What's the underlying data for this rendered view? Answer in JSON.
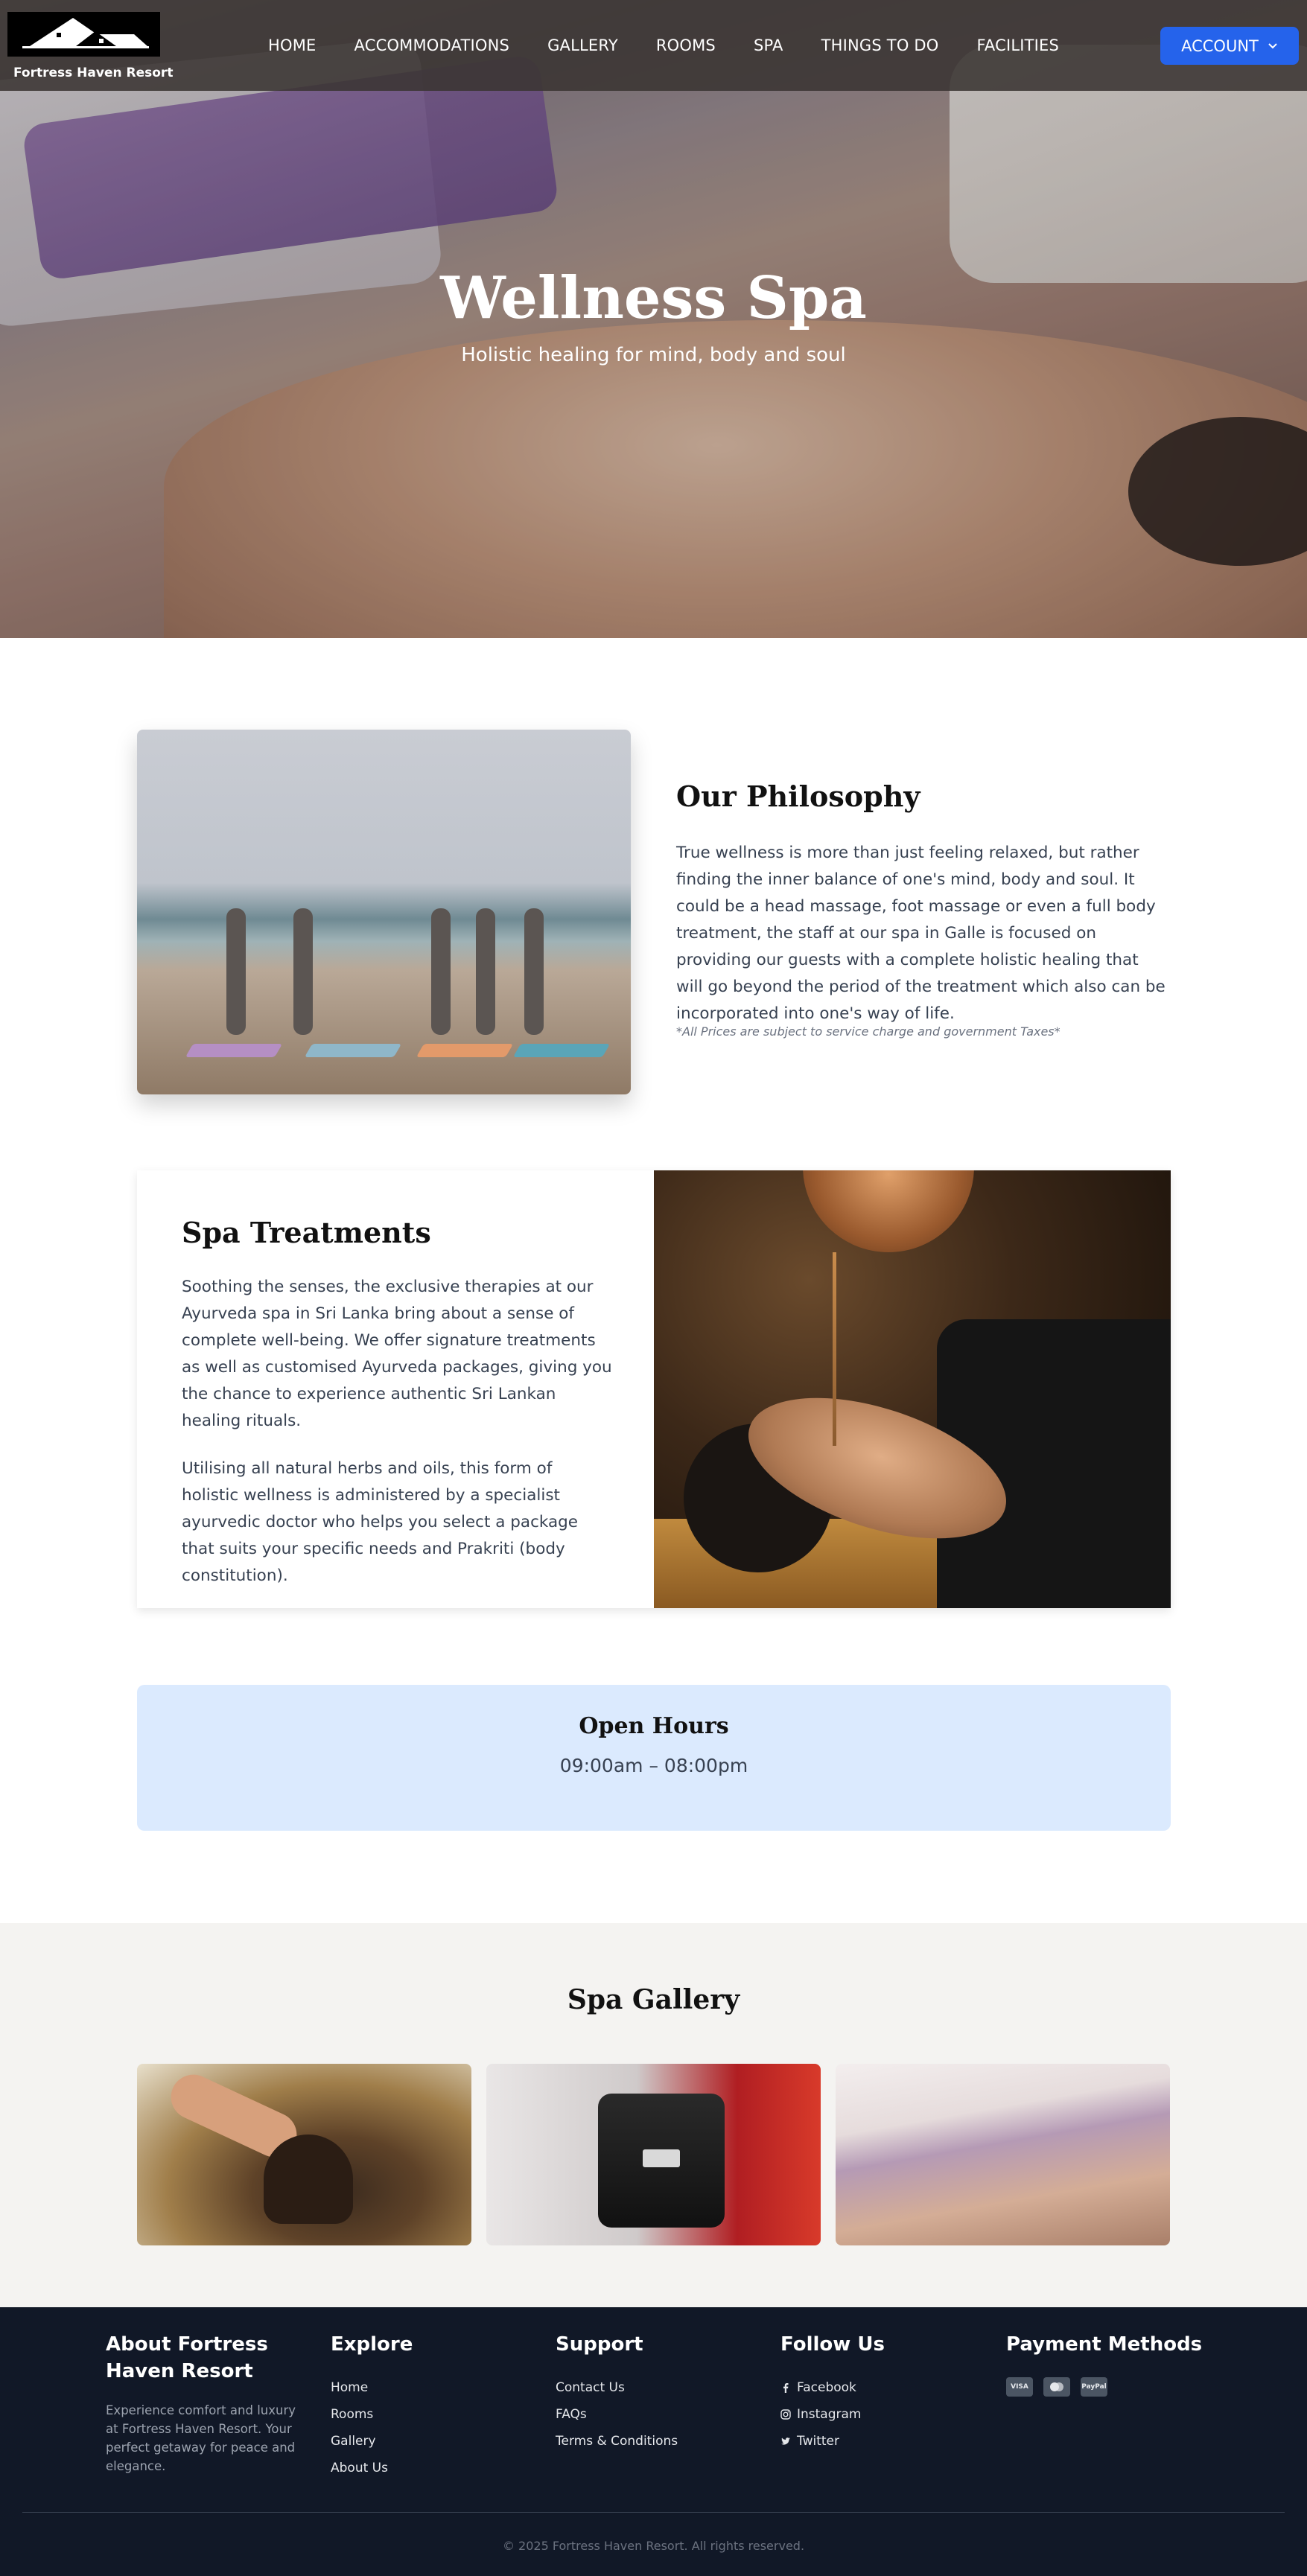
{
  "nav": {
    "brand": "Fortress Haven Resort",
    "items": [
      "HOME",
      "ACCOMMODATIONS",
      "GALLERY",
      "ROOMS",
      "SPA",
      "THINGS TO DO",
      "FACILITIES"
    ],
    "account_label": "ACCOUNT"
  },
  "hero": {
    "title": "Wellness Spa",
    "subtitle": "Holistic healing for mind, body and soul"
  },
  "philosophy": {
    "title": "Our Philosophy",
    "body": "True wellness is more than just feeling relaxed, but rather finding the inner balance of one's mind, body and soul. It could be a head massage, foot massage or even a full body treatment, the staff at our spa in Galle is focused on providing our guests with a complete holistic healing that will go beyond the period of the treatment which also can be incorporated into one's way of life.",
    "note": "*All Prices are subject to service charge and government Taxes*"
  },
  "treatments": {
    "title": "Spa Treatments",
    "p1": "Soothing the senses, the exclusive therapies at our Ayurveda spa in Sri Lanka bring about a sense of complete well-being. We offer signature treatments as well as customised Ayurveda packages, giving you the chance to experience authentic Sri Lankan healing rituals.",
    "p2": "Utilising all natural herbs and oils, this form of holistic wellness is administered by a specialist ayurvedic doctor who helps you select a package that suits your specific needs and Prakriti (body constitution)."
  },
  "hours": {
    "title": "Open Hours",
    "value": "09:00am – 08:00pm"
  },
  "gallery": {
    "title": "Spa Gallery"
  },
  "footer": {
    "about_title": "About Fortress Haven Resort",
    "about_text": "Experience comfort and luxury at Fortress Haven Resort. Your perfect getaway for peace and elegance.",
    "explore_title": "Explore",
    "explore": [
      "Home",
      "Rooms",
      "Gallery",
      "About Us"
    ],
    "support_title": "Support",
    "support": [
      "Contact Us",
      "FAQs",
      "Terms & Conditions"
    ],
    "follow_title": "Follow Us",
    "follow": [
      "Facebook",
      "Instagram",
      "Twitter"
    ],
    "payment_title": "Payment Methods",
    "payments": [
      "VISA",
      "MC",
      "PayPal"
    ],
    "copyright": "© 2025 Fortress Haven Resort. All rights reserved."
  },
  "colors": {
    "accent": "#2563eb",
    "footer_bg": "#111827",
    "hours_bg": "#dbeafe"
  }
}
